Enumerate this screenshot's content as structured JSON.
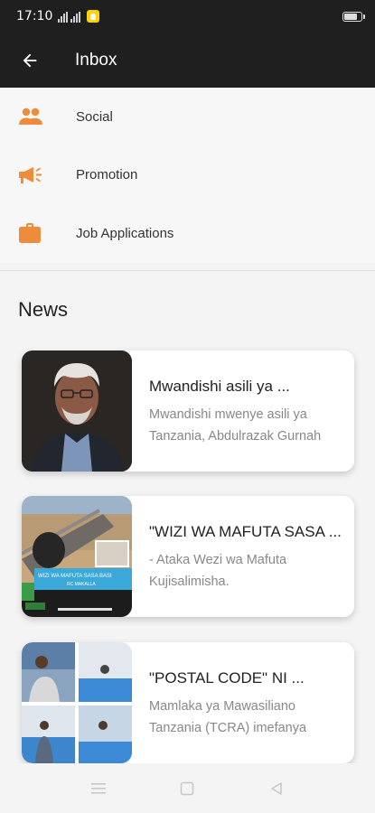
{
  "status": {
    "time": "17:10"
  },
  "appbar": {
    "title": "Inbox"
  },
  "menu": [
    {
      "label": "Social",
      "icon": "people-icon"
    },
    {
      "label": "Promotion",
      "icon": "megaphone-icon"
    },
    {
      "label": "Job Applications",
      "icon": "briefcase-icon"
    }
  ],
  "news": {
    "heading": "News",
    "items": [
      {
        "title": "Mwandishi asili ya ...",
        "subtitle": "Mwandishi mwenye asili ya Tanzania, Abdulrazak Gurnah"
      },
      {
        "title": "\"WIZI WA MAFUTA SASA ...",
        "subtitle": "- Ataka Wezi wa Mafuta Kujisalimisha."
      },
      {
        "title": "\"POSTAL CODE\" NI ...",
        "subtitle": "Mamlaka ya Mawasiliano Tanzania (TCRA) imefanya"
      }
    ]
  },
  "thumb2_text": {
    "banner": "WIZI WA MAFUTA SASA BASI",
    "caption": "RC MAKALLA"
  },
  "colors": {
    "accent": "#ee8c3c",
    "bar": "#1f1f1f"
  }
}
